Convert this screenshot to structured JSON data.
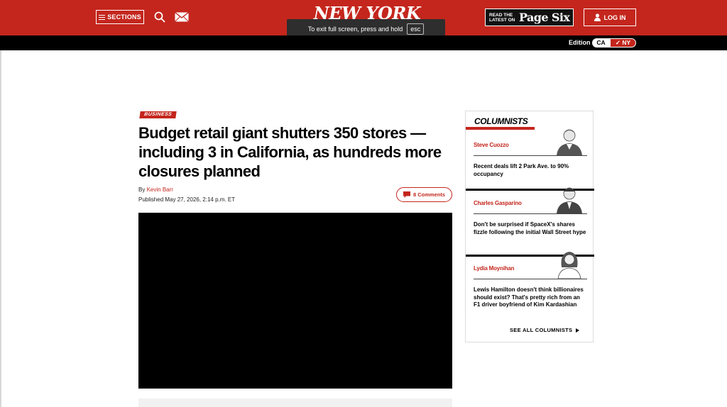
{
  "header": {
    "sections_label": "SECTIONS",
    "logo_text": "NEW YORK POST",
    "fullscreen_notice": "To exit full screen, press and hold",
    "esc_key": "esc",
    "page_six_pre": "READ THE LATEST ON",
    "page_six_brand": "Page Six",
    "login_label": "LOG IN",
    "icons": [
      "menu-icon",
      "search-icon",
      "mail-icon",
      "user-icon"
    ]
  },
  "edition": {
    "label": "Edition",
    "options": [
      "CA",
      "NY"
    ],
    "selected": "NY",
    "selected_mark": "✓"
  },
  "article": {
    "section": "BUSINESS",
    "headline": "Budget retail giant shutters 350 stores — including 3 in California, as hundreds more closures planned",
    "by_prefix": "By",
    "author": "Kevin Barr",
    "published": "Published May 27, 2026, 2:14 p.m. ET",
    "comments_label": "8 Comments"
  },
  "columnists": {
    "title": "COLUMNISTS",
    "items": [
      {
        "name": "Steve Cuozzo",
        "headline": "Recent deals lift 2 Park Ave. to 90% occupancy"
      },
      {
        "name": "Charles Gasparino",
        "headline": "Don't be surprised if SpaceX's shares fizzle following the initial Wall Street hype"
      },
      {
        "name": "Lydia Moynihan",
        "headline": "Lewis Hamilton doesn't think billionaires should exist? That's pretty rich from an F1 driver boyfriend of Kim Kardashian"
      }
    ],
    "see_all_label": "SEE ALL COLUMNISTS"
  },
  "colors": {
    "brand_red": "#c4261d",
    "black": "#000000"
  }
}
